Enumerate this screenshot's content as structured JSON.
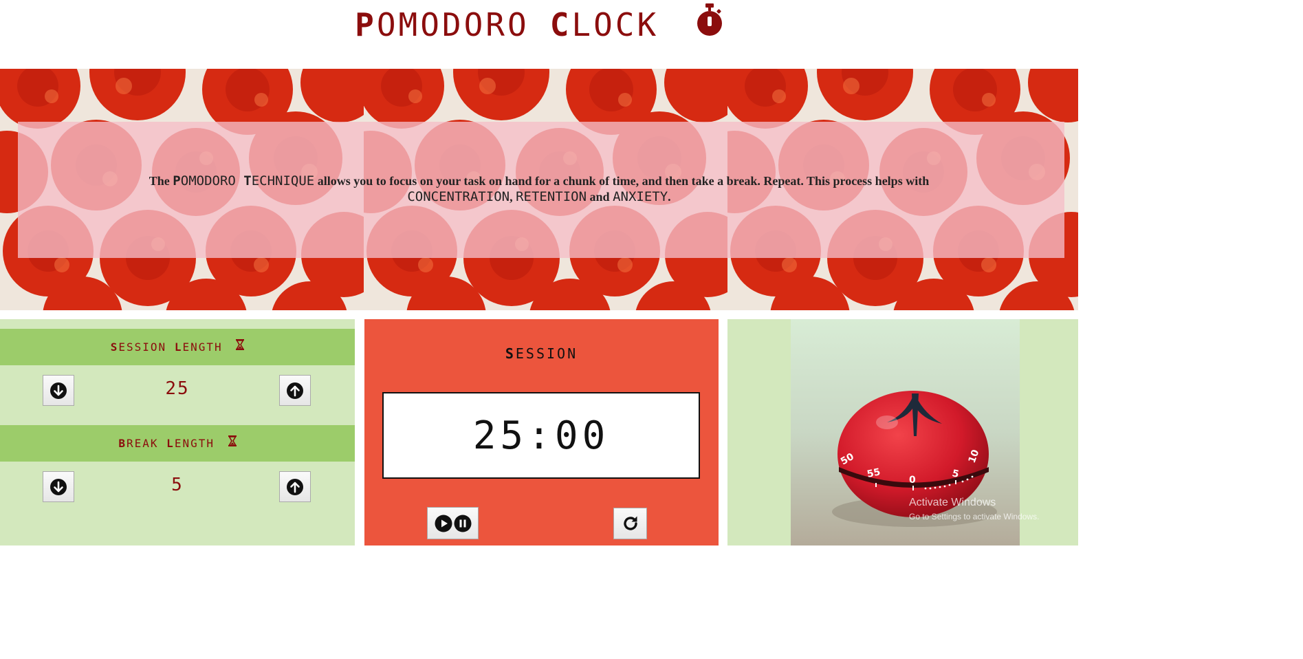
{
  "header": {
    "title_word1_cap": "P",
    "title_word1_rest": "OMODORO",
    "title_word2_cap": "C",
    "title_word2_rest": "LOCK",
    "icon": "stopwatch-icon"
  },
  "banner": {
    "t1": "The ",
    "k1_cap": "P",
    "k1_rest": "OMODORO ",
    "k2_cap": "T",
    "k2_rest": "ECHNIQUE",
    "t2": " allows you to focus on your task on hand for a chunk of time, and then take a break. Repeat. This process helps with ",
    "k3": "CONCENTRATION",
    "t3": ", ",
    "k4": "RETENTION",
    "t4": " and ",
    "k5": "ANXIETY",
    "t5": "."
  },
  "settings": {
    "session": {
      "label_cap1": "S",
      "label_rest1": "ESSION ",
      "label_cap2": "L",
      "label_rest2": "ENGTH",
      "value": "25"
    },
    "break": {
      "label_cap1": "B",
      "label_rest1": "REAK ",
      "label_cap2": "L",
      "label_rest2": "ENGTH",
      "value": "5"
    },
    "icons": {
      "decrement": "arrow-down-circle-icon",
      "increment": "arrow-up-circle-icon",
      "hourglass": "hourglass-icon"
    }
  },
  "timer": {
    "label_cap": "S",
    "label_rest": "ESSION",
    "display": "25:00",
    "icons": {
      "play": "play-icon",
      "pause": "pause-icon",
      "reset": "reset-icon"
    }
  },
  "photo": {
    "dial_labels": [
      "50",
      "55",
      "0",
      "5",
      "10"
    ]
  },
  "watermark": {
    "line1": "Activate Windows",
    "line2": "Go to Settings to activate Windows."
  },
  "colors": {
    "title": "#8b0d0d",
    "bar_green": "#9ccc6a",
    "panel_green": "#d3e8bd",
    "timer_panel": "#ec553d",
    "overlay_pink": "#f5bec8"
  }
}
